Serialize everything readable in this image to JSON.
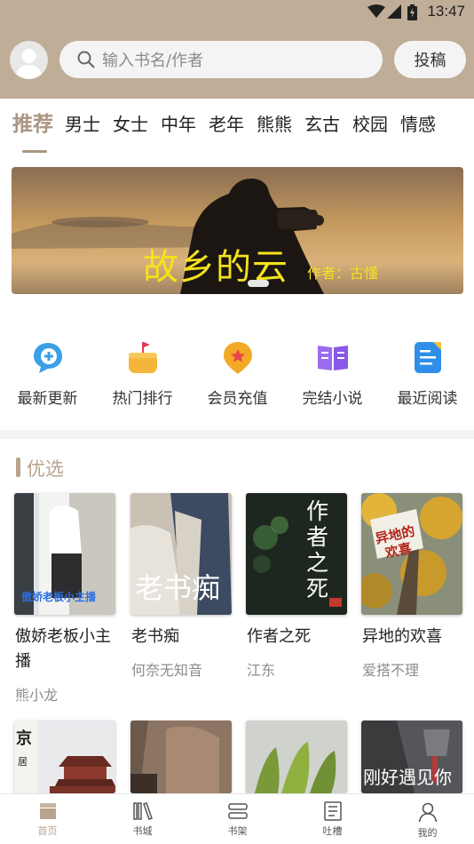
{
  "status_bar": {
    "time": "13:47"
  },
  "header": {
    "search_placeholder": "输入书名/作者",
    "contribute_label": "投稿"
  },
  "tabs": [
    {
      "label": "推荐",
      "active": true
    },
    {
      "label": "男士"
    },
    {
      "label": "女士"
    },
    {
      "label": "中年"
    },
    {
      "label": "老年"
    },
    {
      "label": "熊熊"
    },
    {
      "label": "玄古"
    },
    {
      "label": "校园"
    },
    {
      "label": "情感"
    }
  ],
  "banner": {
    "title": "故乡的云",
    "author": "作者：古懂"
  },
  "quick_links": [
    {
      "label": "最新更新",
      "icon": "chat-plus-icon"
    },
    {
      "label": "热门排行",
      "icon": "bag-flag-icon"
    },
    {
      "label": "会员充值",
      "icon": "star-badge-icon"
    },
    {
      "label": "完结小说",
      "icon": "open-book-icon"
    },
    {
      "label": "最近阅读",
      "icon": "document-icon"
    }
  ],
  "featured": {
    "title": "优选",
    "books": [
      {
        "title": "傲娇老板小主播",
        "author": "熊小龙",
        "cover_text": "傲娇老板小主播"
      },
      {
        "title": "老书痴",
        "author": "何奈无知音",
        "cover_text": "老书痴"
      },
      {
        "title": "作者之死",
        "author": "江东",
        "cover_text": "作者之死"
      },
      {
        "title": "异地的欢喜",
        "author": "爱搭不理",
        "cover_text": "异地的欢喜"
      }
    ],
    "row2_covers": [
      {
        "cover_text": "京",
        "cover_text_2": "居"
      },
      {
        "cover_text": ""
      },
      {
        "cover_text": ""
      },
      {
        "cover_text": "刚好遇见你"
      }
    ]
  },
  "bottom_nav": [
    {
      "label": "首页",
      "active": true
    },
    {
      "label": "书城"
    },
    {
      "label": "书架"
    },
    {
      "label": "吐槽"
    },
    {
      "label": "我的"
    }
  ],
  "colors": {
    "header_bg": "#c0ad98",
    "accent": "#a99682",
    "banner_text": "#f4e21d"
  }
}
